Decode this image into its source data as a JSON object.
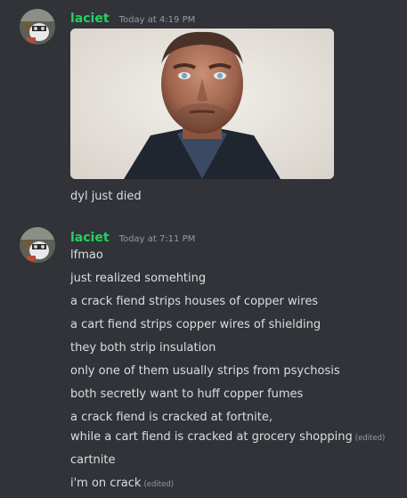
{
  "messages": [
    {
      "author": "laciet",
      "timestamp": "Today at 4:19 PM",
      "lines": [
        "dyl just died"
      ]
    },
    {
      "author": "laciet",
      "timestamp": "Today at 7:11 PM",
      "lines": [
        "lfmao",
        "just realized somehting",
        "a crack fiend strips houses of copper wires",
        "a cart fiend strips copper wires of shielding",
        "they both strip insulation",
        "only one of them usually strips from psychosis",
        "both secretly want to huff copper fumes",
        "a crack fiend is cracked at fortnite,",
        "while a cart fiend is cracked at grocery shopping",
        "cartnite",
        "i'm on crack"
      ],
      "edited_label": "(edited)"
    }
  ],
  "colors": {
    "background": "#313338",
    "username": "#23d160",
    "text": "#dbdee1",
    "muted": "#949ba4"
  }
}
